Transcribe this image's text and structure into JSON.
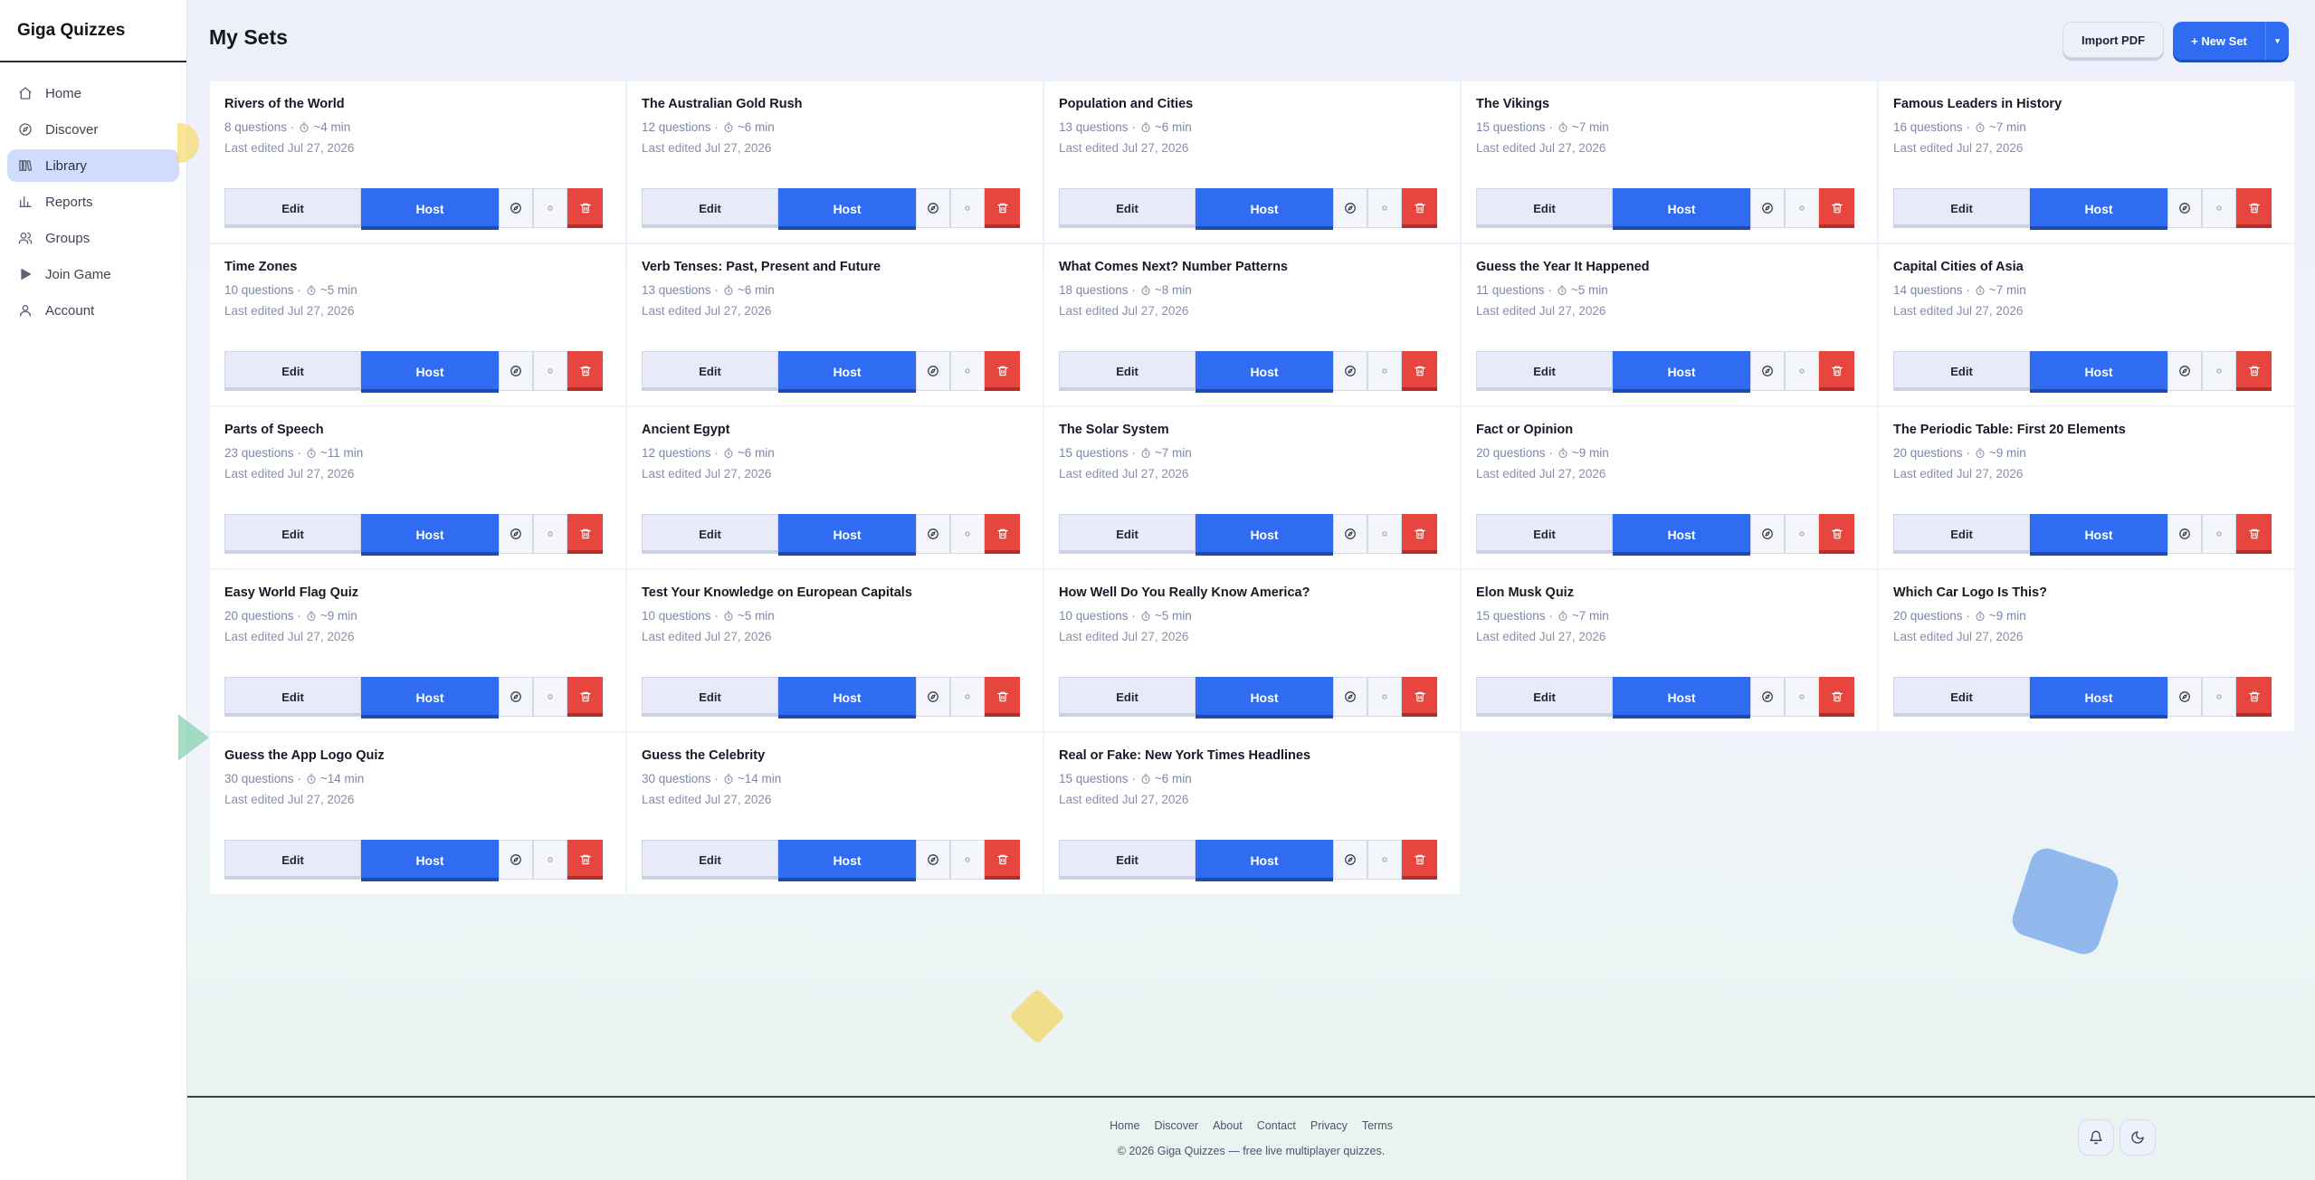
{
  "app": {
    "brand": "Giga Quizzes"
  },
  "nav": [
    {
      "label": "Home",
      "icon": "home-icon",
      "active": false
    },
    {
      "label": "Discover",
      "icon": "compass-icon",
      "active": false
    },
    {
      "label": "Library",
      "icon": "library-icon",
      "active": true
    },
    {
      "label": "Reports",
      "icon": "bar-chart-icon",
      "active": false
    },
    {
      "label": "Groups",
      "icon": "users-icon",
      "active": false
    },
    {
      "label": "Join Game",
      "icon": "play-icon",
      "active": false
    },
    {
      "label": "Account",
      "icon": "user-icon",
      "active": false
    }
  ],
  "header": {
    "title": "My Sets",
    "import_label": "Import PDF",
    "new_label": "+ New Set",
    "new_caret": "▾"
  },
  "card_labels": {
    "edit": "Edit",
    "host": "Host"
  },
  "sets": [
    {
      "title": "Rivers of the World",
      "questions": "8 questions",
      "duration": "~4 min",
      "edited": "Last edited Jul 27, 2026"
    },
    {
      "title": "The Australian Gold Rush",
      "questions": "12 questions",
      "duration": "~6 min",
      "edited": "Last edited Jul 27, 2026"
    },
    {
      "title": "Population and Cities",
      "questions": "13 questions",
      "duration": "~6 min",
      "edited": "Last edited Jul 27, 2026"
    },
    {
      "title": "The Vikings",
      "questions": "15 questions",
      "duration": "~7 min",
      "edited": "Last edited Jul 27, 2026"
    },
    {
      "title": "Famous Leaders in History",
      "questions": "16 questions",
      "duration": "~7 min",
      "edited": "Last edited Jul 27, 2026"
    },
    {
      "title": "Time Zones",
      "questions": "10 questions",
      "duration": "~5 min",
      "edited": "Last edited Jul 27, 2026"
    },
    {
      "title": "Verb Tenses: Past, Present and Future",
      "questions": "13 questions",
      "duration": "~6 min",
      "edited": "Last edited Jul 27, 2026"
    },
    {
      "title": "What Comes Next? Number Patterns",
      "questions": "18 questions",
      "duration": "~8 min",
      "edited": "Last edited Jul 27, 2026"
    },
    {
      "title": "Guess the Year It Happened",
      "questions": "11 questions",
      "duration": "~5 min",
      "edited": "Last edited Jul 27, 2026"
    },
    {
      "title": "Capital Cities of Asia",
      "questions": "14 questions",
      "duration": "~7 min",
      "edited": "Last edited Jul 27, 2026"
    },
    {
      "title": "Parts of Speech",
      "questions": "23 questions",
      "duration": "~11 min",
      "edited": "Last edited Jul 27, 2026"
    },
    {
      "title": "Ancient Egypt",
      "questions": "12 questions",
      "duration": "~6 min",
      "edited": "Last edited Jul 27, 2026"
    },
    {
      "title": "The Solar System",
      "questions": "15 questions",
      "duration": "~7 min",
      "edited": "Last edited Jul 27, 2026"
    },
    {
      "title": "Fact or Opinion",
      "questions": "20 questions",
      "duration": "~9 min",
      "edited": "Last edited Jul 27, 2026"
    },
    {
      "title": "The Periodic Table: First 20 Elements",
      "questions": "20 questions",
      "duration": "~9 min",
      "edited": "Last edited Jul 27, 2026"
    },
    {
      "title": "Easy World Flag Quiz",
      "questions": "20 questions",
      "duration": "~9 min",
      "edited": "Last edited Jul 27, 2026"
    },
    {
      "title": "Test Your Knowledge on European Capitals",
      "questions": "10 questions",
      "duration": "~5 min",
      "edited": "Last edited Jul 27, 2026"
    },
    {
      "title": "How Well Do You Really Know America?",
      "questions": "10 questions",
      "duration": "~5 min",
      "edited": "Last edited Jul 27, 2026"
    },
    {
      "title": "Elon Musk Quiz",
      "questions": "15 questions",
      "duration": "~7 min",
      "edited": "Last edited Jul 27, 2026"
    },
    {
      "title": "Which Car Logo Is This?",
      "questions": "20 questions",
      "duration": "~9 min",
      "edited": "Last edited Jul 27, 2026"
    },
    {
      "title": "Guess the App Logo Quiz",
      "questions": "30 questions",
      "duration": "~14 min",
      "edited": "Last edited Jul 27, 2026"
    },
    {
      "title": "Guess the Celebrity",
      "questions": "30 questions",
      "duration": "~14 min",
      "edited": "Last edited Jul 27, 2026"
    },
    {
      "title": "Real or Fake: New York Times Headlines",
      "questions": "15 questions",
      "duration": "~6 min",
      "edited": "Last edited Jul 27, 2026"
    }
  ],
  "footer": {
    "links": [
      "Home",
      "Discover",
      "About",
      "Contact",
      "Privacy",
      "Terms"
    ],
    "copyright": "© 2026 Giga Quizzes — free live multiplayer quizzes."
  },
  "colors": {
    "accent": "#2f6cf2",
    "danger": "#e7463f",
    "active_nav": "#cfdcfb"
  }
}
